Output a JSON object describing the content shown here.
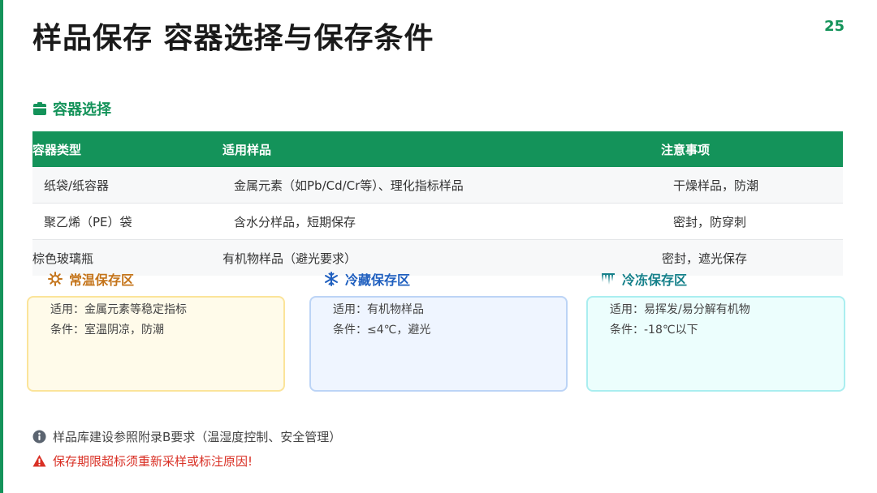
{
  "page": {
    "title": "样品保存 容器选择与保存条件",
    "number": "25"
  },
  "container_section": {
    "heading": "容器选择",
    "headers": [
      "容器类型",
      "适用样品",
      "注意事项"
    ],
    "rows": [
      [
        "纸袋/纸容器",
        "金属元素（如Pb/Cd/Cr等）、理化指标样品",
        "干燥样品，防潮"
      ],
      [
        "聚乙烯（PE）袋",
        "含水分样品，短期保存",
        "密封，防穿刺"
      ],
      [
        "棕色玻璃瓶",
        "有机物样品（避光要求）",
        "密封，遮光保存"
      ]
    ]
  },
  "zones": [
    {
      "title": "常温保存区",
      "icon": "sun-icon",
      "color": "#c4741a",
      "line1": "适用：金属元素等稳定指标",
      "line2": "条件：室温阴凉，防潮"
    },
    {
      "title": "冷藏保存区",
      "icon": "snowflake-icon",
      "color": "#1f5fbf",
      "line1": "适用：有机物样品",
      "line2": "条件：≤4℃，避光"
    },
    {
      "title": "冷冻保存区",
      "icon": "icicles-icon",
      "color": "#15808a",
      "line1": "适用：易挥发/易分解有机物",
      "line2": "条件：-18℃以下"
    }
  ],
  "notes": {
    "info": "样品库建设参照附录B要求（温湿度控制、安全管理）",
    "warning": "保存期限超标须重新采样或标注原因!"
  },
  "colors": {
    "accent": "#14935a",
    "warning": "#d93025"
  }
}
